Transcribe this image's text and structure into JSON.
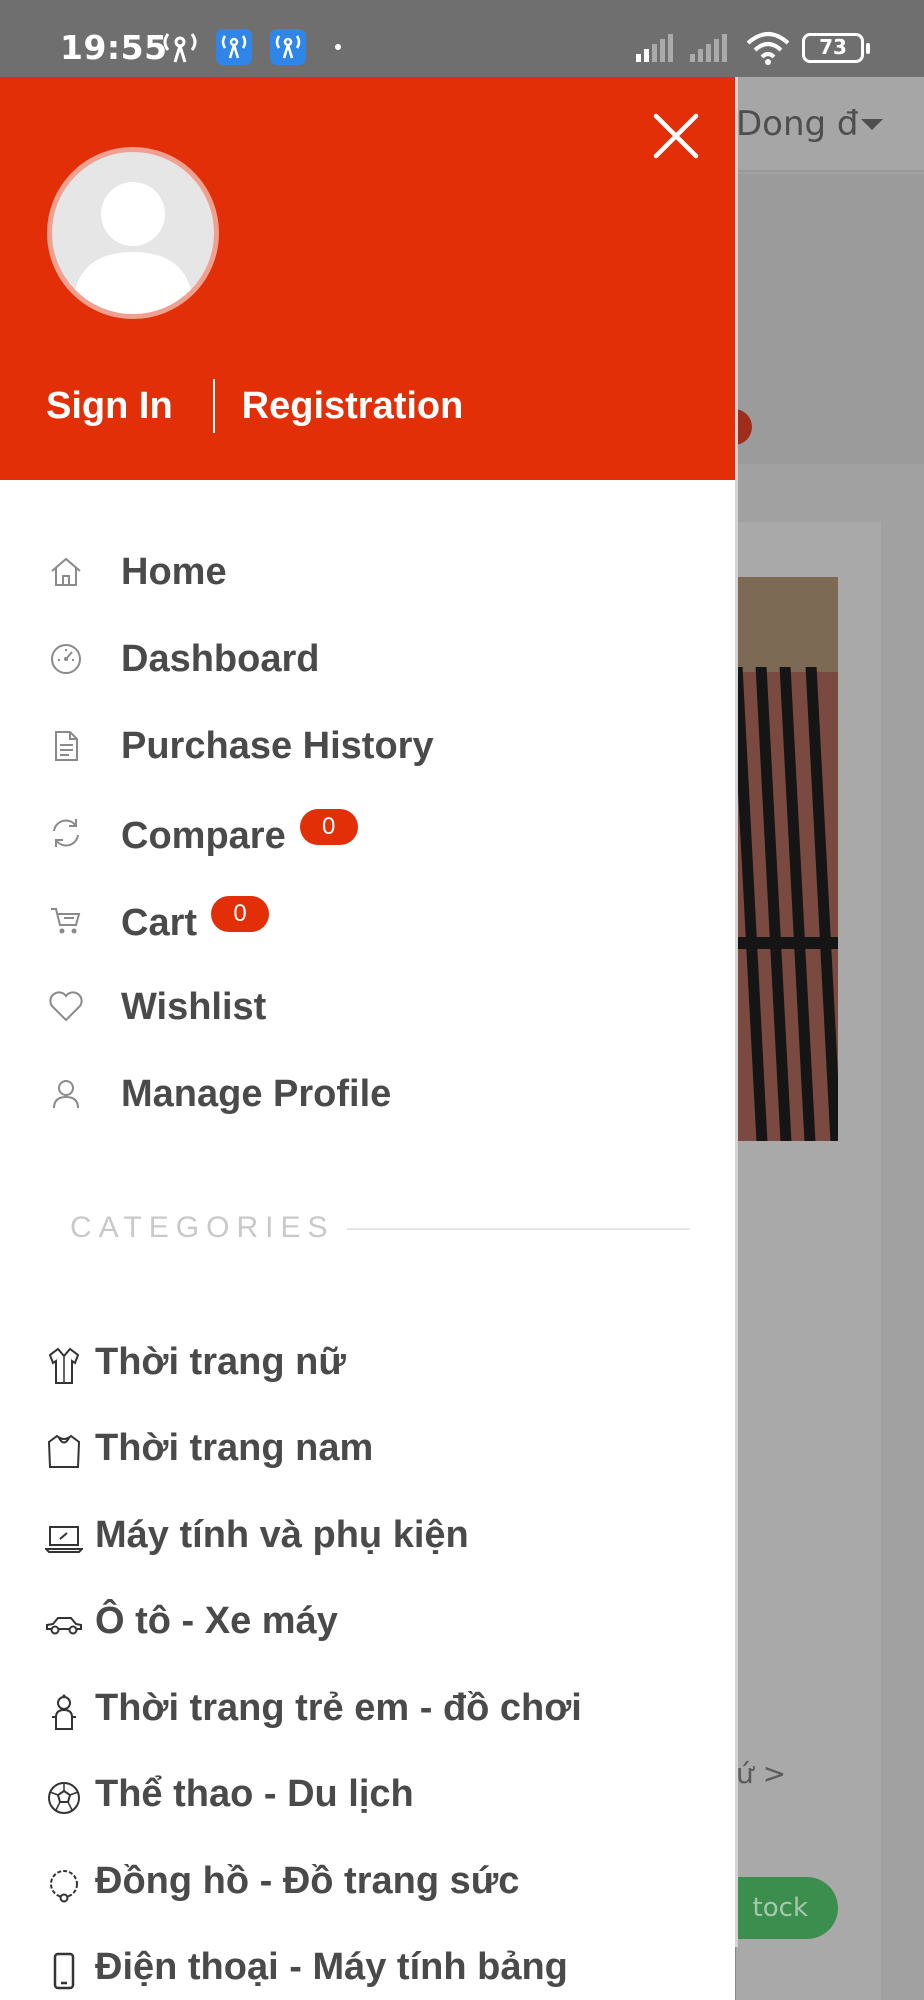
{
  "status_bar": {
    "time": "19:55",
    "battery": "73"
  },
  "background": {
    "currency": "Dong đ",
    "link_text": "ứ >",
    "button_text": "tock"
  },
  "drawer": {
    "auth": {
      "sign_in": "Sign In",
      "registration": "Registration"
    },
    "menu": [
      {
        "label": "Home",
        "icon": "home-icon"
      },
      {
        "label": "Dashboard",
        "icon": "dashboard-icon"
      },
      {
        "label": "Purchase History",
        "icon": "document-icon"
      },
      {
        "label": "Compare",
        "icon": "refresh-icon",
        "badge": "0"
      },
      {
        "label": "Cart",
        "icon": "cart-icon",
        "badge": "0"
      },
      {
        "label": "Wishlist",
        "icon": "heart-icon"
      },
      {
        "label": "Manage Profile",
        "icon": "user-icon"
      }
    ],
    "categories_title": "CATEGORIES",
    "categories": [
      {
        "label": "Thời trang nữ",
        "icon": "dress-icon"
      },
      {
        "label": "Thời trang nam",
        "icon": "shirt-icon"
      },
      {
        "label": "Máy tính và phụ kiện",
        "icon": "laptop-icon"
      },
      {
        "label": "Ô tô - Xe máy",
        "icon": "car-icon"
      },
      {
        "label": "Thời trang trẻ em - đồ chơi",
        "icon": "baby-icon"
      },
      {
        "label": "Thể thao - Du lịch",
        "icon": "soccer-ball-icon"
      },
      {
        "label": "Đồng hồ - Đồ trang sức",
        "icon": "necklace-icon"
      },
      {
        "label": "Điện thoại - Máy tính bảng",
        "icon": "phone-icon"
      }
    ]
  },
  "colors": {
    "accent": "#e22f08",
    "text": "#4a4a4a",
    "muted": "#c9c9c9"
  }
}
